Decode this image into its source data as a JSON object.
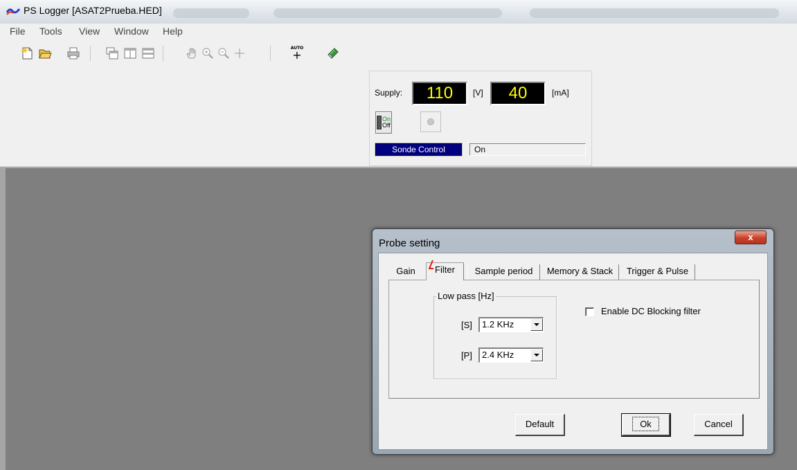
{
  "window": {
    "title": "PS Logger [ASAT2Prueba.HED]"
  },
  "menu": [
    "File",
    "Tools",
    "View",
    "Window",
    "Help"
  ],
  "toolbar": {
    "buttons": [
      "new-file-icon",
      "open-folder-icon",
      "print-icon",
      "cascade-windows-icon",
      "tile-vertical-icon",
      "tile-horizontal-icon",
      "pan-hand-icon",
      "zoom-in-icon",
      "zoom-out-icon",
      "crosshair-icon",
      "auto-scale-icon",
      "book-icon"
    ],
    "auto_label": "AUTO",
    "auto_plus": "+"
  },
  "sonde_panel": {
    "supply_label": "Supply:",
    "voltage_value": "110",
    "voltage_unit": "[V]",
    "current_value": "40",
    "current_unit": "[mA]",
    "toggle_on": "On",
    "toggle_off": "Off",
    "control_label": "Sonde Control",
    "status_value": "On"
  },
  "dialog": {
    "title": "Probe setting",
    "close_label": "x",
    "tabs": [
      {
        "label": "Gain",
        "active": false
      },
      {
        "label": "Filter",
        "active": true
      },
      {
        "label": "Sample period",
        "active": false
      },
      {
        "label": "Memory & Stack",
        "active": false
      },
      {
        "label": "Trigger & Pulse",
        "active": false
      }
    ],
    "lowpass": {
      "legend": "Low pass [Hz]",
      "s_label": "[S]",
      "s_value": "1.2 KHz",
      "p_label": "[P]",
      "p_value": "2.4 KHz"
    },
    "dc_blocking": {
      "label": "Enable DC Blocking filter",
      "checked": false
    },
    "buttons": {
      "default": "Default",
      "ok": "Ok",
      "cancel": "Cancel"
    }
  },
  "colors": {
    "lcd_background": "#000000",
    "lcd_text": "#ffff00",
    "sonde_label_bg": "#000080",
    "workspace": "#7f7f7f",
    "close_button": "#c8412a",
    "cursor_marker": "#e02010"
  }
}
